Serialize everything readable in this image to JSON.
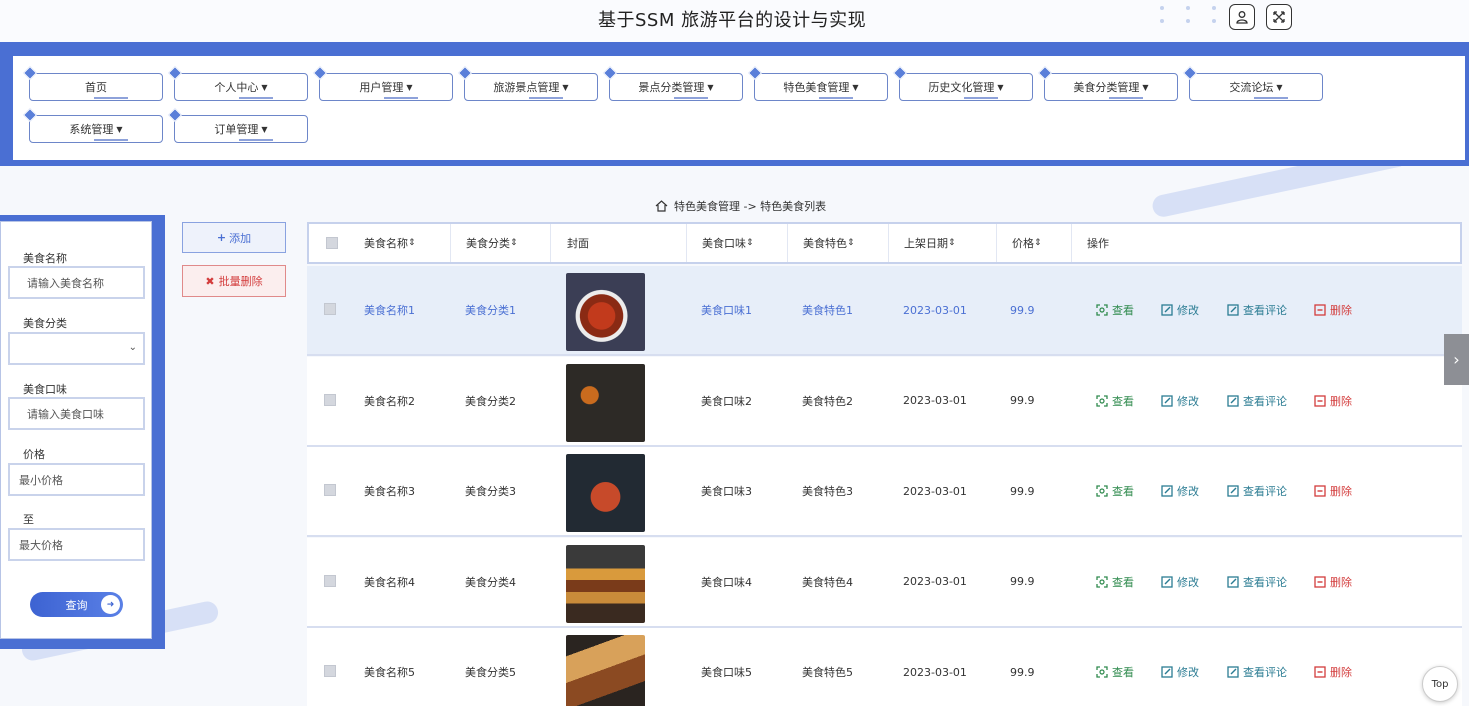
{
  "header": {
    "title": "基于SSM 旅游平台的设计与实现"
  },
  "nav": {
    "items": [
      {
        "label": "首页",
        "caret": false
      },
      {
        "label": "个人中心",
        "caret": true
      },
      {
        "label": "用户管理",
        "caret": true
      },
      {
        "label": "旅游景点管理",
        "caret": true
      },
      {
        "label": "景点分类管理",
        "caret": true
      },
      {
        "label": "特色美食管理",
        "caret": true
      },
      {
        "label": "历史文化管理",
        "caret": true
      },
      {
        "label": "美食分类管理",
        "caret": true
      },
      {
        "label": "交流论坛",
        "caret": true
      },
      {
        "label": "系统管理",
        "caret": true
      },
      {
        "label": "订单管理",
        "caret": true
      }
    ]
  },
  "search": {
    "name_label": "美食名称",
    "name_placeholder": "请输入美食名称",
    "category_label": "美食分类",
    "taste_label": "美食口味",
    "taste_placeholder": "请输入美食口味",
    "price_label": "价格",
    "min_placeholder": "最小价格",
    "to_label": "至",
    "max_placeholder": "最大价格",
    "query_label": "查询"
  },
  "actions": {
    "add_label": "添加",
    "batch_delete_label": "批量删除"
  },
  "breadcrumb": {
    "text": "特色美食管理 -> 特色美食列表"
  },
  "table": {
    "headers": [
      "美食名称",
      "美食分类",
      "封面",
      "美食口味",
      "美食特色",
      "上架日期",
      "价格",
      "操作"
    ],
    "sort_mark": "⇕",
    "row_actions": {
      "view": "查看",
      "edit": "修改",
      "comments": "查看评论",
      "delete": "删除"
    },
    "rows": [
      {
        "name": "美食名称1",
        "category": "美食分类1",
        "taste": "美食口味1",
        "feature": "美食特色1",
        "date": "2023-03-01",
        "price": "99.9",
        "highlight": true
      },
      {
        "name": "美食名称2",
        "category": "美食分类2",
        "taste": "美食口味2",
        "feature": "美食特色2",
        "date": "2023-03-01",
        "price": "99.9",
        "highlight": false
      },
      {
        "name": "美食名称3",
        "category": "美食分类3",
        "taste": "美食口味3",
        "feature": "美食特色3",
        "date": "2023-03-01",
        "price": "99.9",
        "highlight": false
      },
      {
        "name": "美食名称4",
        "category": "美食分类4",
        "taste": "美食口味4",
        "feature": "美食特色4",
        "date": "2023-03-01",
        "price": "99.9",
        "highlight": false
      },
      {
        "name": "美食名称5",
        "category": "美食分类5",
        "taste": "美食口味5",
        "feature": "美食特色5",
        "date": "2023-03-01",
        "price": "99.9",
        "highlight": false
      }
    ]
  },
  "top_button": {
    "label": "Top"
  },
  "colors": {
    "primary": "#4a6fd3",
    "danger": "#d33c3c",
    "success": "#2f8a4d",
    "teal": "#2b7c93",
    "highlight_row": "#e7eef9"
  },
  "icons": {
    "user": "user-icon",
    "fullscreen": "fullscreen-icon",
    "home": "home-icon",
    "next": "chevron-right-icon"
  }
}
